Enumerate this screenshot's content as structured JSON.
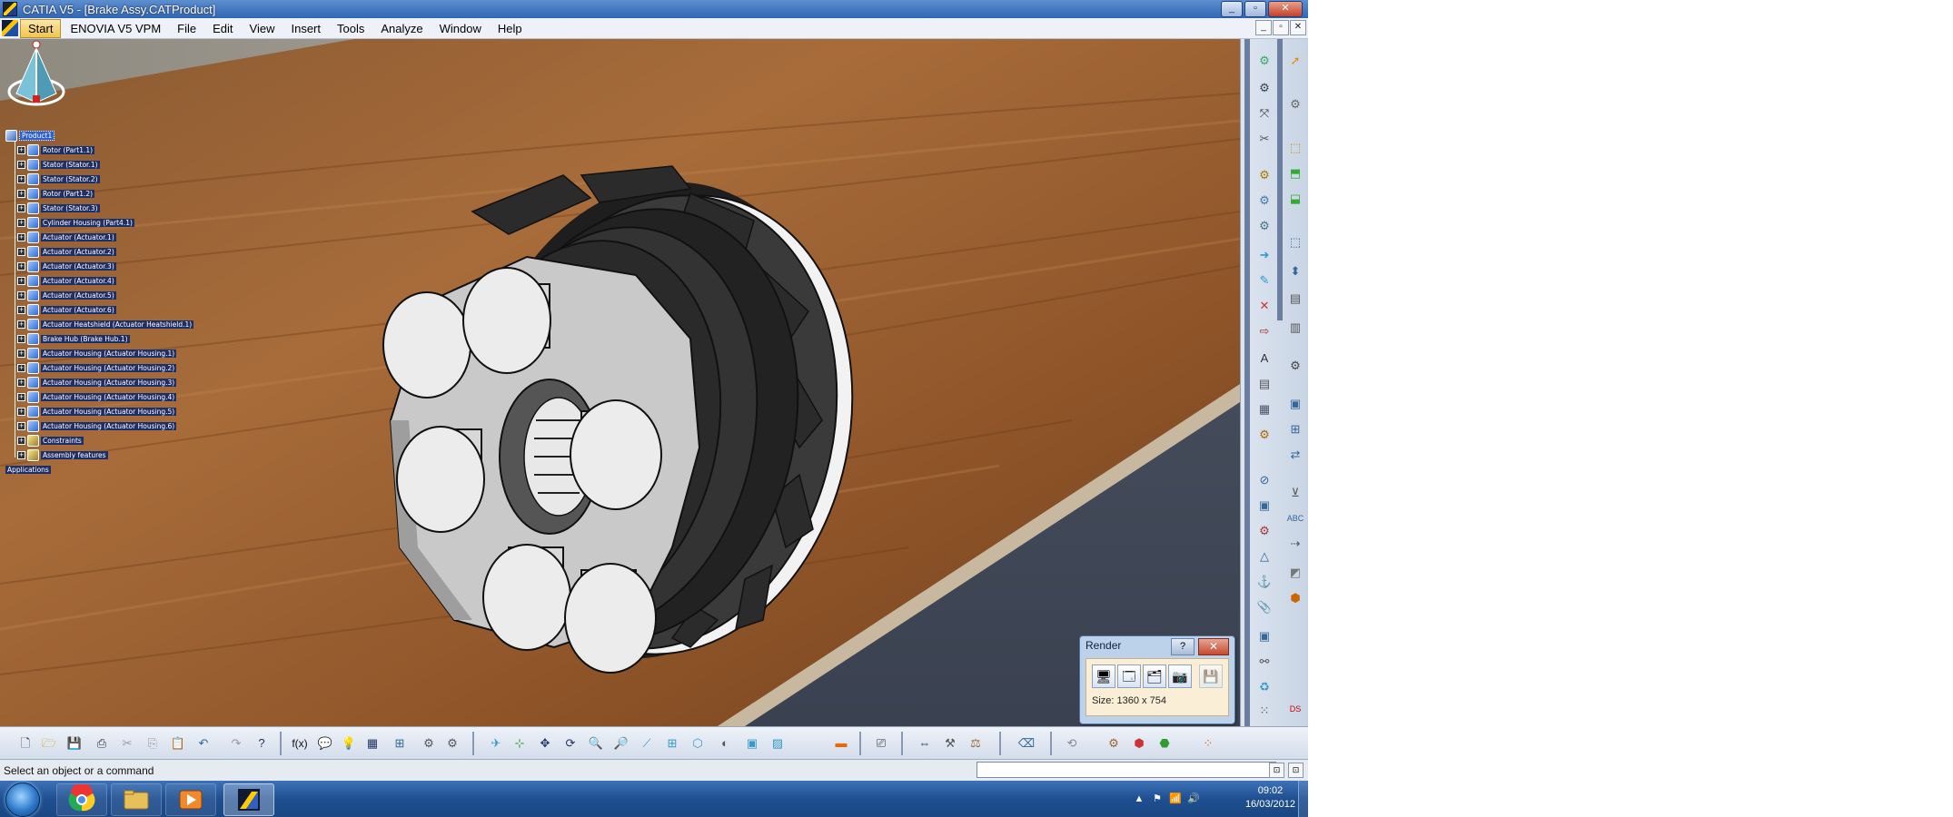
{
  "window": {
    "title": "CATIA V5 - [Brake Assy.CATProduct]",
    "controls": [
      "_",
      "▫",
      "✕"
    ]
  },
  "menu": {
    "items": [
      "Start",
      "ENOVIA V5 VPM",
      "File",
      "Edit",
      "View",
      "Insert",
      "Tools",
      "Analyze",
      "Window",
      "Help"
    ],
    "doc_controls": [
      "_",
      "▫",
      "✕"
    ]
  },
  "spec_tree": {
    "root": "Product1",
    "children": [
      "Rotor (Part1.1)",
      "Stator (Stator.1)",
      "Stator (Stator.2)",
      "Rotor (Part1.2)",
      "Stator (Stator.3)",
      "Cylinder Housing (Part4.1)",
      "Actuator (Actuator.1)",
      "Actuator (Actuator.2)",
      "Actuator (Actuator.3)",
      "Actuator (Actuator.4)",
      "Actuator (Actuator.5)",
      "Actuator (Actuator.6)",
      "Actuator Heatshield (Actuator Heatshield.1)",
      "Brake Hub (Brake Hub.1)",
      "Actuator Housing (Actuator Housing.1)",
      "Actuator Housing (Actuator Housing.2)",
      "Actuator Housing (Actuator Housing.3)",
      "Actuator Housing (Actuator Housing.4)",
      "Actuator Housing (Actuator Housing.5)",
      "Actuator Housing (Actuator Housing.6)"
    ],
    "constraints": "Constraints",
    "assembly_features": "Assembly features",
    "applications": "Applications"
  },
  "render_dialog": {
    "title": "Render",
    "help": "?",
    "close": "✕",
    "size_text": "Size: 1360 x 754"
  },
  "status": {
    "message": "Select an object or a command",
    "command_value": "",
    "buttons": [
      "⊡",
      "⊡"
    ]
  },
  "taskbar": {
    "time": "09:02",
    "date": "16/03/2012"
  },
  "colors": {
    "title_bar": "#3a72c0",
    "tree_label_bg": "#1d2f66",
    "taskbar": "#1f4f91",
    "render_panel": "#fbeed7"
  }
}
